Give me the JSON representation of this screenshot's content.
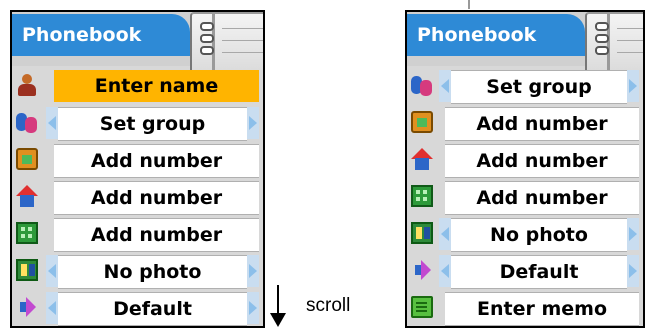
{
  "left_screen": {
    "title": "Phonebook",
    "rows": [
      {
        "icon": "person-icon",
        "label": "Enter name",
        "style": "highlight"
      },
      {
        "icon": "group-icon",
        "label": "Set group",
        "style": "selector"
      },
      {
        "icon": "mobile-phone-icon",
        "label": "Add number",
        "style": "field"
      },
      {
        "icon": "home-icon",
        "label": "Add number",
        "style": "field"
      },
      {
        "icon": "office-icon",
        "label": "Add number",
        "style": "field"
      },
      {
        "icon": "photo-icon",
        "label": "No photo",
        "style": "selector"
      },
      {
        "icon": "ringtone-icon",
        "label": "Default",
        "style": "selector"
      }
    ]
  },
  "right_screen": {
    "title": "Phonebook",
    "rows": [
      {
        "icon": "group-icon",
        "label": "Set group",
        "style": "selector"
      },
      {
        "icon": "mobile-phone-icon",
        "label": "Add number",
        "style": "field"
      },
      {
        "icon": "home-icon",
        "label": "Add number",
        "style": "field"
      },
      {
        "icon": "office-icon",
        "label": "Add number",
        "style": "field"
      },
      {
        "icon": "photo-icon",
        "label": "No photo",
        "style": "selector"
      },
      {
        "icon": "ringtone-icon",
        "label": "Default",
        "style": "selector"
      },
      {
        "icon": "memo-icon",
        "label": "Enter memo",
        "style": "field"
      }
    ]
  },
  "scroll_label": "scroll",
  "colors": {
    "title_bar": "#2e8ad6",
    "highlight": "#ffb400",
    "selector_arrow": "#8cbfea"
  }
}
